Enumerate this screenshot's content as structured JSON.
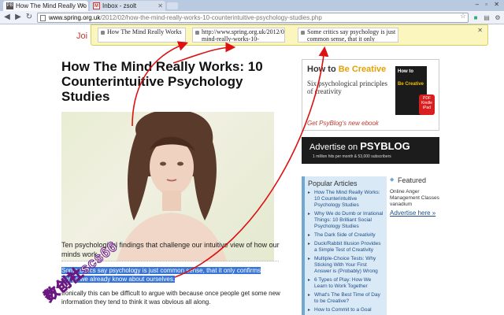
{
  "browser": {
    "tabs": [
      {
        "title": "How The Mind Really Wo",
        "favicon": "PB"
      },
      {
        "title": "Inbox - zsolt",
        "favicon": "M"
      }
    ],
    "url_domain": "www.spring.org.uk",
    "url_path": "/2012/02/how-the-mind-really-works-10-counterintuitive-psychology-studies.php"
  },
  "stickies": [
    "How The Mind Really Works",
    "http://www.spring.org.uk/2012/02/the-mind-really-works-10-",
    "Some critics say psychology is just common sense, that it only"
  ],
  "page": {
    "join_text": "Joi",
    "title": "How The Mind Really Works: 10 Counterintuitive Psychology Studies",
    "intro": "Ten psychological findings that challenge our intuitive view of how our minds work.",
    "highlight": "Some critics say psychology is just common sense, that it only confirms things we already know about ourselves.",
    "paragraph": "Ironically this can be difficult to argue with because once people get some new information they tend to think it was obvious all along."
  },
  "ads": {
    "creative_heading_pre": "How to ",
    "creative_heading_accent": "Be Creative",
    "creative_sub": "Six psychological principles of creativity",
    "creative_link": "Get PsyBlog's new ebook",
    "book_title": "How to",
    "book_title_accent": "Be Creative",
    "badge": "PDF Kindle iPad",
    "advertise_pre": "Advertise on ",
    "advertise_brand": "PSYBLOG",
    "advertise_sub": "1 million hits per month & 53,000 subscribers"
  },
  "sidebar": {
    "popular_title": "Popular Articles",
    "popular_items": [
      "How The Mind Really Works: 10 Counterintuitive Psychology Studies",
      "Why We do Dumb or Irrational Things: 10 Brilliant Social Psychology Studies",
      "The Dark Side of Creativity",
      "Duck/Rabbit Illusion Provides a Simple Test of Creativity",
      "Multiple-Choice Tests: Why Sticking With Your First Answer is (Probably) Wrong",
      "6 Types of Play: How We Learn to Work Together",
      "What's The Best Time of Day to be Creative?",
      "How to Commit to a Goal"
    ],
    "featured_title": "Featured",
    "featured_text": "Online Anger Management Classes vanadium",
    "featured_link": "Advertise here »"
  },
  "watermark": "数创社scs66"
}
